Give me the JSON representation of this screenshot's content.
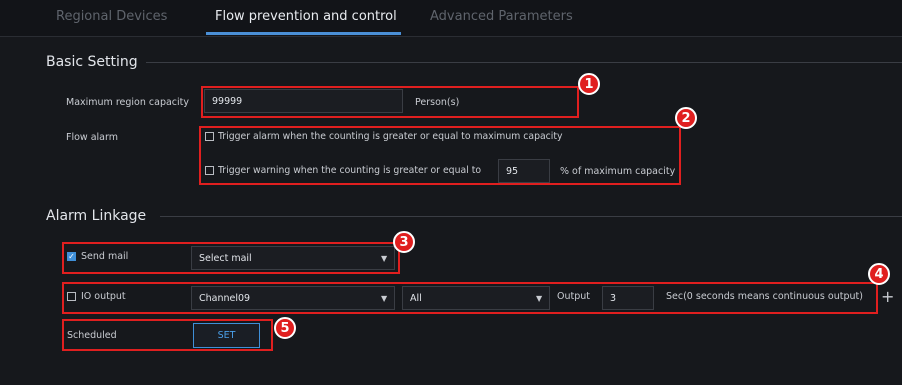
{
  "tabs": [
    {
      "label": "Regional Devices"
    },
    {
      "label": "Flow prevention and control"
    },
    {
      "label": "Advanced Parameters"
    }
  ],
  "basic": {
    "title": "Basic Setting",
    "capacity_label": "Maximum region capacity",
    "capacity_value": "99999",
    "capacity_unit": "Person(s)",
    "flow_alarm_label": "Flow alarm",
    "alarm_option": "Trigger alarm when the counting is greater or equal to maximum capacity",
    "warning_option": "Trigger warning when the counting is greater or equal to",
    "warning_value": "95",
    "warning_suffix": "%  of maximum capacity"
  },
  "linkage": {
    "title": "Alarm Linkage",
    "send_mail_label": "Send mail",
    "send_mail_checked": true,
    "mail_select": "Select mail",
    "io_label": "IO output",
    "io_checked": false,
    "channel_select": "Channel09",
    "all_select": "All",
    "output_label": "Output",
    "output_value": "3",
    "output_hint": "Sec(0 seconds means continuous output)",
    "scheduled_label": "Scheduled",
    "set_button": "SET"
  },
  "callouts": [
    "1",
    "2",
    "3",
    "4",
    "5"
  ],
  "colors": {
    "accent": "#4a8fd6",
    "callout": "#e01f1f",
    "background": "#16181c"
  }
}
